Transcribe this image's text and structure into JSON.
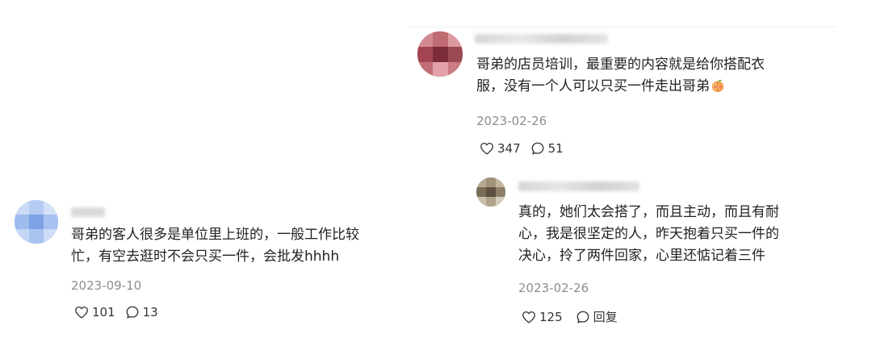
{
  "comments": [
    {
      "text_lines": [
        "哥弟的客人很多是单位里上班的，一般工作比较",
        "忙，有空去逛时不会只买一件，会批发hhhh"
      ],
      "date": "2023-09-10",
      "likes": "101",
      "replies": "13"
    },
    {
      "text_lines": [
        "哥弟的店员培训，最重要的内容就是给你搭配衣",
        "服，没有一个人可以只买一件走出哥弟"
      ],
      "emoji": "peach",
      "date": "2023-02-26",
      "likes": "347",
      "replies": "51"
    },
    {
      "text_lines": [
        "真的，她们太会搭了，而且主动，而且有耐",
        "心，我是很坚定的人，昨天抱着只买一件的",
        "决心，拎了两件回家，心里还惦记着三件"
      ],
      "date": "2023-02-26",
      "likes": "125",
      "reply_label": "回复"
    }
  ]
}
